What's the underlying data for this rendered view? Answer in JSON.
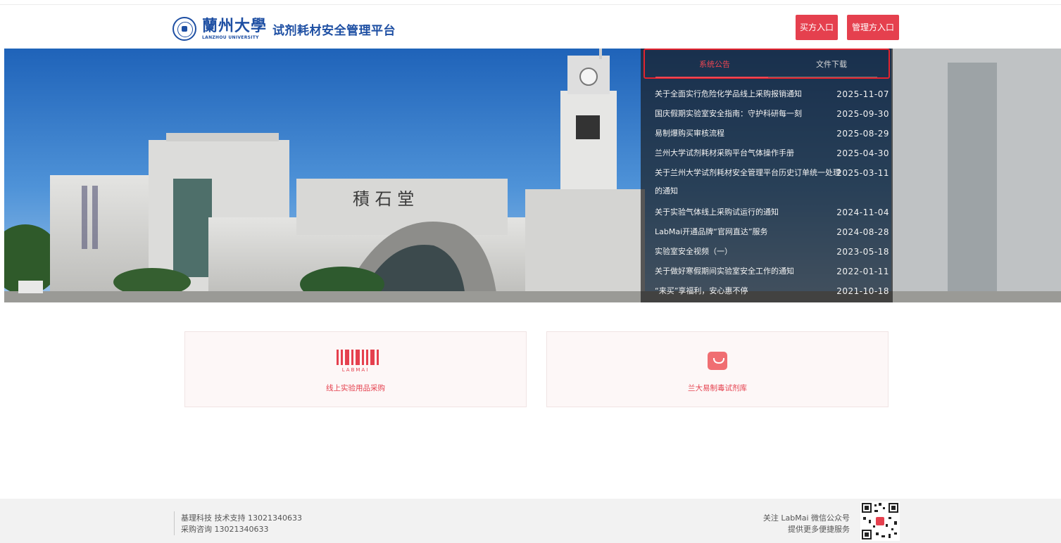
{
  "header": {
    "university_cn": "蘭州大學",
    "university_en": "LANZHOU UNIVERSITY",
    "platform_title": "试剂耗材安全管理平台",
    "buyer_entry": "买方入口",
    "admin_entry": "管理方入口"
  },
  "banner": {
    "building_sign": "積 石 堂"
  },
  "notice": {
    "tabs": [
      "系统公告",
      "文件下载"
    ],
    "active_tab": 0,
    "items": [
      {
        "title": "关于全面实行危险化学品线上采购报销通知",
        "date": "2025-11-07"
      },
      {
        "title": "国庆假期实验室安全指南：守护科研每一刻",
        "date": "2025-09-30"
      },
      {
        "title": "易制爆购买审核流程",
        "date": "2025-08-29"
      },
      {
        "title": "兰州大学试剂耗材采购平台气体操作手册",
        "date": "2025-04-30"
      },
      {
        "title": "关于兰州大学试剂耗材安全管理平台历史订单统一处理的通知",
        "date": "2025-03-11"
      },
      {
        "title": "关于实验气体线上采购试运行的通知",
        "date": "2024-11-04"
      },
      {
        "title": "LabMai开通品牌“官网直达”服务",
        "date": "2024-08-28"
      },
      {
        "title": "实验室安全视频（一）",
        "date": "2023-05-18"
      },
      {
        "title": "关于做好寒假期间实验室安全工作的通知",
        "date": "2022-01-11"
      },
      {
        "title": "“来买”享福利，安心惠不停",
        "date": "2021-10-18"
      }
    ]
  },
  "cards": [
    {
      "label": "线上实验用品采购",
      "icon": "labmai-logo-icon",
      "icon_text": "LABMAI"
    },
    {
      "label": "兰大易制毒试剂库",
      "icon": "shopping-bag-icon"
    }
  ],
  "footer": {
    "support": "基理科技 技术支持 13021340633",
    "consult": "采购咨询 13021340633",
    "follow": "关注 LabMai 微信公众号",
    "more": "提供更多便捷服务"
  },
  "colors": {
    "accent": "#e5404e",
    "brand_blue": "#1e4fa3",
    "footer_bg": "#f2f2f2"
  }
}
